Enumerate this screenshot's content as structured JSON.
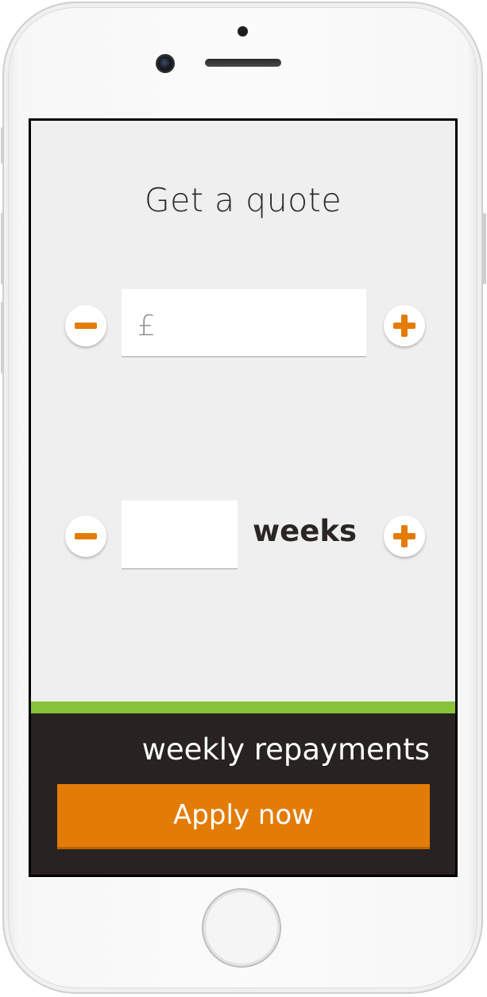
{
  "screen": {
    "title": "Get a quote"
  },
  "amount": {
    "currency_symbol": "£",
    "value": "",
    "decrease_icon": "minus-icon",
    "increase_icon": "plus-icon"
  },
  "duration": {
    "value": "",
    "unit_label": "weeks",
    "decrease_icon": "minus-icon",
    "increase_icon": "plus-icon"
  },
  "footer": {
    "repayments_label": "weekly repayments",
    "apply_label": "Apply now"
  },
  "colors": {
    "accent": "#e37c07",
    "strip": "#88c43a",
    "panel": "#282221",
    "background": "#efefef"
  }
}
